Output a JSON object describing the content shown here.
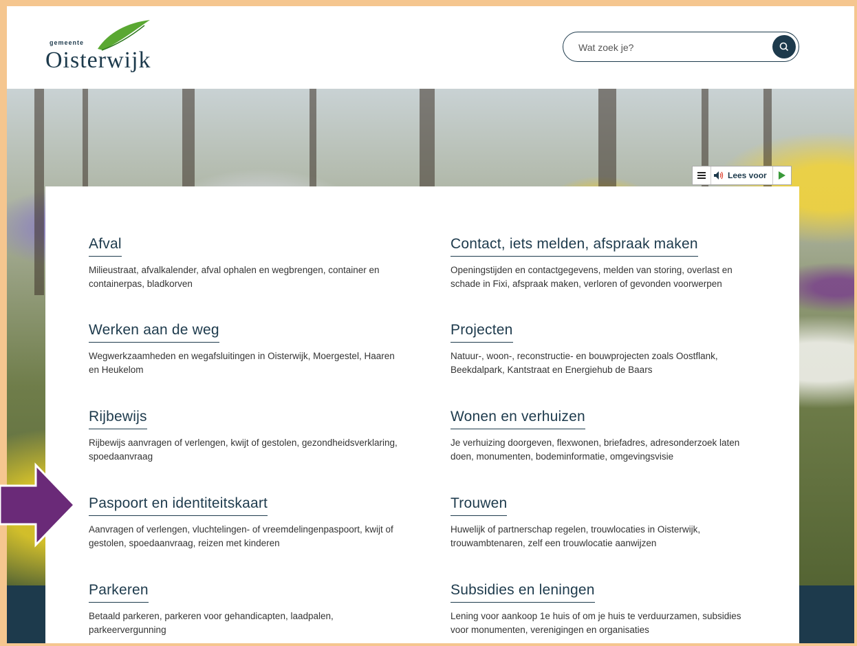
{
  "header": {
    "logo_small": "gemeente",
    "logo_big": "Oisterwijk",
    "search_placeholder": "Wat zoek je?"
  },
  "readspeaker": {
    "label": "Lees voor"
  },
  "topics": [
    {
      "title": "Afval",
      "desc": "Milieustraat, afvalkalender, afval ophalen en wegbrengen, container en containerpas, bladkorven"
    },
    {
      "title": "Contact, iets melden, afspraak maken",
      "desc": "Openingstijden en contactgegevens, melden van storing, overlast en schade in Fixi, afspraak maken, verloren of gevonden voorwerpen"
    },
    {
      "title": "Werken aan de weg",
      "desc": "Wegwerkzaamheden en wegafsluitingen in Oisterwijk, Moergestel, Haaren en Heukelom"
    },
    {
      "title": "Projecten",
      "desc": "Natuur-, woon-, reconstructie- en bouwprojecten zoals Oostflank, Beekdalpark, Kantstraat en Energiehub de Baars"
    },
    {
      "title": "Rijbewijs",
      "desc": "Rijbewijs aanvragen of verlengen, kwijt of gestolen, gezondheidsverklaring, spoedaanvraag"
    },
    {
      "title": "Wonen en verhuizen",
      "desc": "Je verhuizing doorgeven, flexwonen, briefadres, adresonderzoek laten doen, monumenten, bodeminformatie, omgevingsvisie"
    },
    {
      "title": "Paspoort en identiteitskaart",
      "desc": "Aanvragen of verlengen, vluchtelingen- of vreemdelingenpaspoort, kwijt of gestolen, spoedaanvraag, reizen met kinderen"
    },
    {
      "title": "Trouwen",
      "desc": "Huwelijk of partnerschap regelen, trouwlocaties in Oisterwijk, trouwambtenaren, zelf een trouwlocatie aanwijzen"
    },
    {
      "title": "Parkeren",
      "desc": "Betaald parkeren, parkeren voor gehandicapten, laadpalen, parkeervergunning"
    },
    {
      "title": "Subsidies en leningen",
      "desc": "Lening voor aankoop 1e huis of om je huis te verduurzamen, subsidies voor monumenten, verenigingen en organisaties"
    }
  ],
  "colors": {
    "brand": "#1d3a4c",
    "arrow": "#6a2a78",
    "frame": "#f5c68f"
  }
}
